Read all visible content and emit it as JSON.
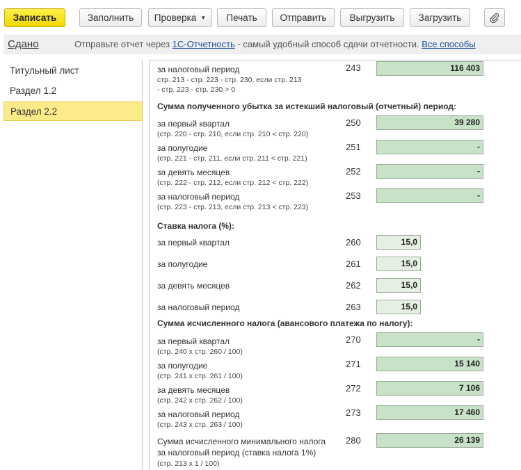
{
  "toolbar": {
    "save": "Записать",
    "fill": "Заполнить",
    "check": "Проверка",
    "print": "Печать",
    "send": "Отправить",
    "export": "Выгрузить",
    "import": "Загрузить"
  },
  "infobar": {
    "status": "Сдано",
    "text1": "Отправьте отчет через ",
    "link1": "1С-Отчетность",
    "text2": " - самый удобный способ сдачи отчетности. ",
    "link2": "Все способы"
  },
  "sidebar": {
    "items": [
      {
        "label": "Титульный лист"
      },
      {
        "label": "Раздел 1.2"
      },
      {
        "label": "Раздел 2.2"
      }
    ]
  },
  "form": {
    "r243": {
      "label": "за налоговый период",
      "sub1": "стр. 213 - стр. 223 - стр. 230, если стр. 213",
      "sub2": "- стр. 223 - стр. 230 > 0",
      "code": "243",
      "value": "116 403"
    },
    "h_loss": "Сумма полученного убытка за истекший налоговый (отчетный) период:",
    "r250": {
      "label": "за первый квартал",
      "sub": "(стр. 220 - стр. 210, если стр. 210 < стр. 220)",
      "code": "250",
      "value": "39 280"
    },
    "r251": {
      "label": "за полугодие",
      "sub": "(стр. 221 - стр. 211, если стр. 211 < стр. 221)",
      "code": "251",
      "value": "-"
    },
    "r252": {
      "label": "за девять месяцев",
      "sub": "(стр. 222 - стр. 212, если стр. 212 < стр. 222)",
      "code": "252",
      "value": "-"
    },
    "r253": {
      "label": "за налоговый период",
      "sub": "(стр. 223 - стр. 213, если стр. 213 < стр. 223)",
      "code": "253",
      "value": "-"
    },
    "h_rate": "Ставка налога (%):",
    "r260": {
      "label": "за первый квартал",
      "code": "260",
      "value": "15,0"
    },
    "r261": {
      "label": "за полугодие",
      "code": "261",
      "value": "15,0"
    },
    "r262": {
      "label": "за девять месяцев",
      "code": "262",
      "value": "15,0"
    },
    "r263": {
      "label": "за налоговый период",
      "code": "263",
      "value": "15,0"
    },
    "h_tax": "Сумма исчисленного налога (авансового платежа по налогу):",
    "r270": {
      "label": "за первый квартал",
      "sub": "(стр. 240 х стр. 260 / 100)",
      "code": "270",
      "value": "-"
    },
    "r271": {
      "label": "за полугодие",
      "sub": "(стр. 241 х стр. 261 / 100)",
      "code": "271",
      "value": "15 140"
    },
    "r272": {
      "label": "за девять месяцев",
      "sub": "(стр. 242 х стр. 262 / 100)",
      "code": "272",
      "value": "7 106"
    },
    "r273": {
      "label": "за налоговый период",
      "sub": "(стр. 243 х стр. 263 / 100)",
      "code": "273",
      "value": "17 460"
    },
    "r280": {
      "label1": "Сумма исчисленного минимального налога",
      "label2": "за налоговый период (ставка налога 1%)",
      "sub": "(стр. 213 х 1 / 100)",
      "code": "280",
      "value": "26 139"
    }
  },
  "colors": {
    "accent": "#f2d600",
    "field": "#c8e2c8",
    "active_item": "#fdeb8a",
    "link": "#1c4fa0"
  },
  "icons": {
    "attach": "paperclip-icon",
    "dropdown": "caret-down-icon"
  }
}
